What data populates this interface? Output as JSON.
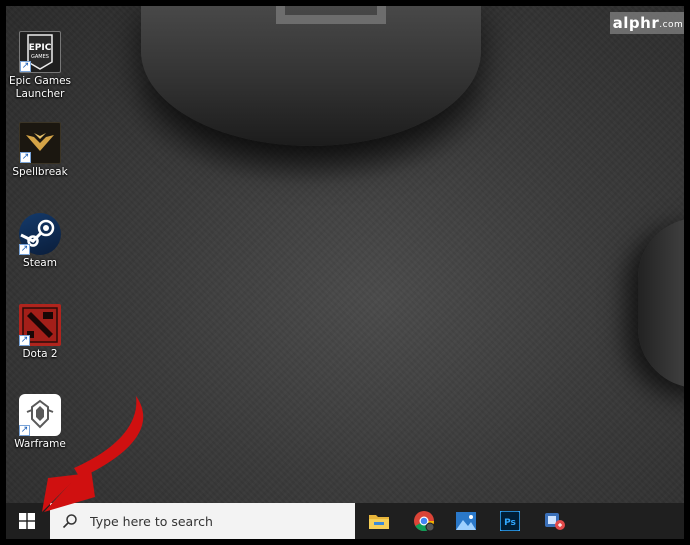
{
  "watermark": {
    "brand": "alphr",
    "suffix": ".com"
  },
  "desktop_icons": [
    {
      "label": "Epic Games Launcher",
      "logo_text": "EPIC GAMES",
      "icon": "epic-games-icon"
    },
    {
      "label": "Spellbreak",
      "icon": "spellbreak-icon"
    },
    {
      "label": "Steam",
      "icon": "steam-icon"
    },
    {
      "label": "Dota 2",
      "icon": "dota2-icon"
    },
    {
      "label": "Warframe",
      "icon": "warframe-icon"
    }
  ],
  "taskbar": {
    "search_placeholder": "Type here to search",
    "apps": [
      {
        "icon": "file-explorer-icon"
      },
      {
        "icon": "chrome-icon"
      },
      {
        "icon": "photos-icon"
      },
      {
        "icon": "photoshop-icon",
        "text": "Ps"
      },
      {
        "icon": "snip-tool-icon"
      }
    ]
  },
  "colors": {
    "arrow": "#d01010",
    "taskbar": "#1f1f1f",
    "windows_blue": "#ffffff"
  }
}
